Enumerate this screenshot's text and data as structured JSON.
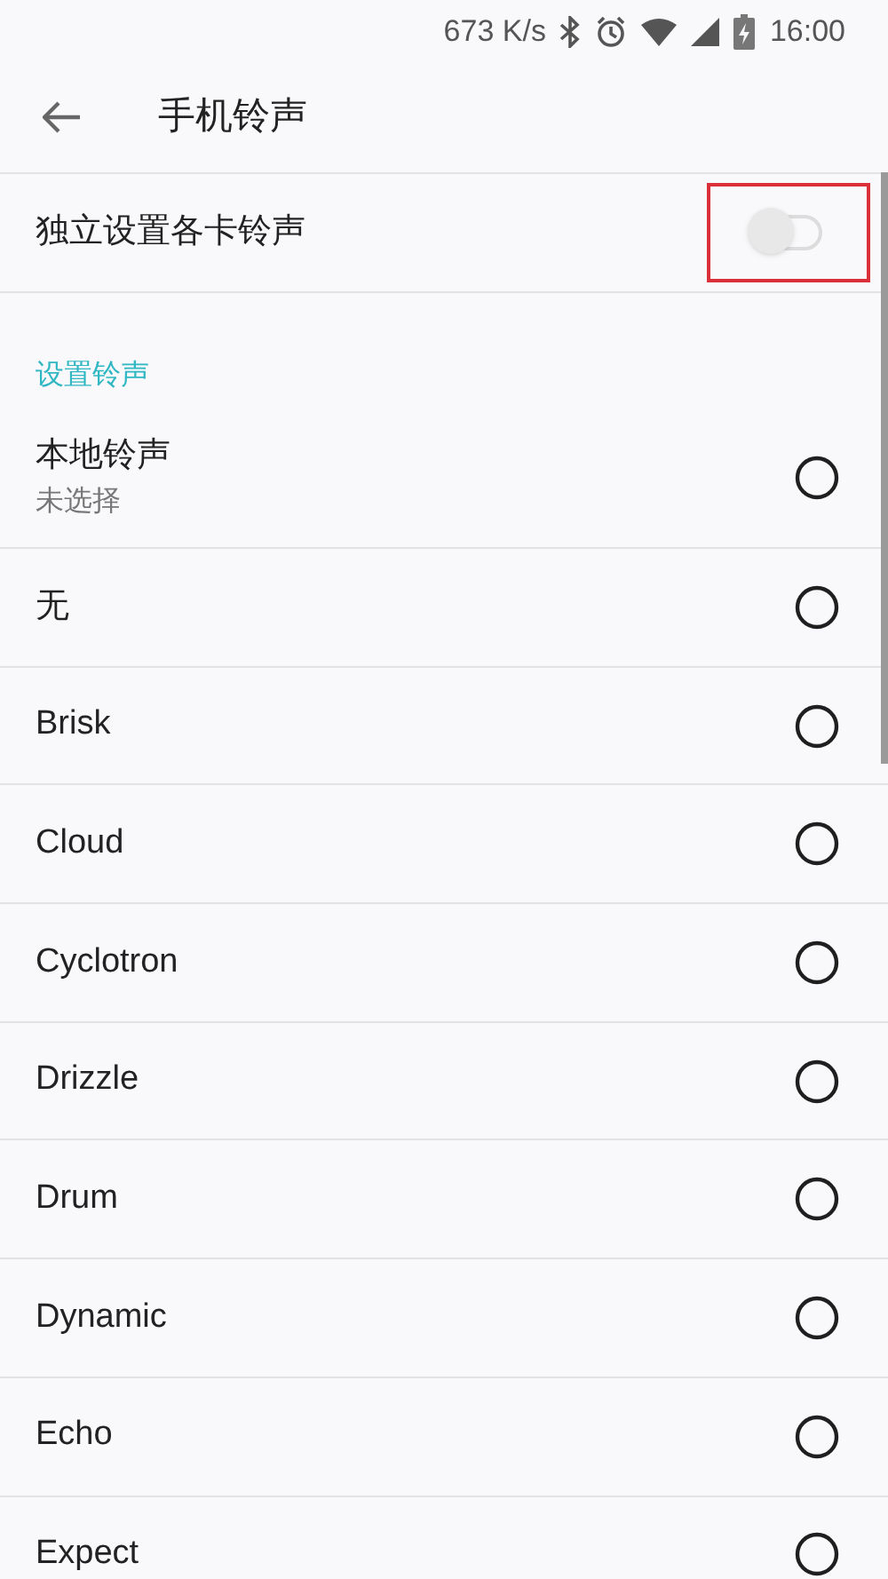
{
  "status_bar": {
    "speed": "673 K/s",
    "time": "16:00"
  },
  "header": {
    "title": "手机铃声"
  },
  "switch_row": {
    "label": "独立设置各卡铃声",
    "on": false,
    "highlighted": true
  },
  "section": {
    "title": "设置铃声"
  },
  "ringtones": [
    {
      "label": "本地铃声",
      "sublabel": "未选择",
      "selected": false
    },
    {
      "label": "无",
      "selected": false
    },
    {
      "label": "Brisk",
      "selected": false
    },
    {
      "label": "Cloud",
      "selected": false
    },
    {
      "label": "Cyclotron",
      "selected": false
    },
    {
      "label": "Drizzle",
      "selected": false
    },
    {
      "label": "Drum",
      "selected": false
    },
    {
      "label": "Dynamic",
      "selected": false
    },
    {
      "label": "Echo",
      "selected": false
    },
    {
      "label": "Expect",
      "selected": false
    }
  ]
}
